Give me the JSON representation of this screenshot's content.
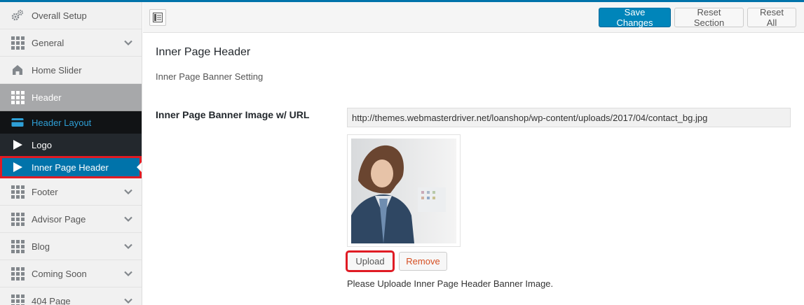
{
  "sidebar": {
    "items": [
      {
        "label": "Overall Setup",
        "icon": "gears-icon"
      },
      {
        "label": "General",
        "icon": "grid-icon"
      },
      {
        "label": "Home Slider",
        "icon": "home-icon"
      },
      {
        "label": "Header",
        "icon": "grid-icon"
      }
    ],
    "sub_items": [
      {
        "label": "Header Layout",
        "icon": "credit-card-icon"
      },
      {
        "label": "Logo",
        "icon": "play-icon"
      },
      {
        "label": "Inner Page Header",
        "icon": "play-icon"
      }
    ],
    "more_items": [
      {
        "label": "Footer",
        "icon": "grid-icon"
      },
      {
        "label": "Advisor Page",
        "icon": "grid-icon"
      },
      {
        "label": "Blog",
        "icon": "grid-icon"
      },
      {
        "label": "Coming Soon",
        "icon": "grid-icon"
      },
      {
        "label": "404 Page",
        "icon": "grid-icon"
      }
    ]
  },
  "toolbar": {
    "save_label": "Save Changes",
    "reset_section_label": "Reset Section",
    "reset_all_label": "Reset All"
  },
  "main": {
    "section_title": "Inner Page Header",
    "section_desc": "Inner Page Banner Setting",
    "field_label": "Inner Page Banner Image w/ URL",
    "field_value": "http://themes.webmasterdriver.net/loanshop/wp-content/uploads/2017/04/contact_bg.jpg",
    "upload_label": "Upload",
    "remove_label": "Remove",
    "help_text": "Please Uploade Inner Page Header Banner Image."
  },
  "colors": {
    "accent": "#0073aa",
    "highlight_border": "#e01b24",
    "remove_text": "#d54e21"
  }
}
